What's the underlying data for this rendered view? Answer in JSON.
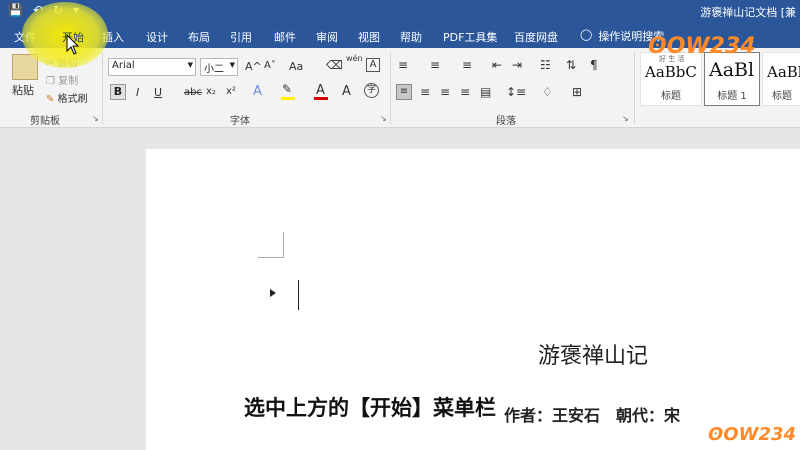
{
  "titlebar": {
    "save_icon": "save-icon",
    "undo_icon": "undo-icon",
    "redo_icon": "redo-icon",
    "doc_title": "游褒禅山记文档 [兼"
  },
  "tabs": [
    "文件",
    "开始",
    "插入",
    "设计",
    "布局",
    "引用",
    "邮件",
    "审阅",
    "视图",
    "帮助",
    "PDF工具集",
    "百度网盘"
  ],
  "tell_me": "操作说明搜索",
  "clipboard": {
    "paste": "粘贴",
    "cut": "剪切",
    "copy": "复制",
    "format_painter": "格式刷",
    "label": "剪贴板"
  },
  "font": {
    "name": "Arial",
    "size": "小二",
    "bold": "B",
    "italic": "I",
    "underline": "U",
    "strike": "abc",
    "subscript": "x₂",
    "superscript": "x²",
    "grow": "A^",
    "shrink": "A˅",
    "case": "Aa",
    "phonetic": "wén",
    "label": "字体"
  },
  "paragraph": {
    "label": "段落"
  },
  "styles": [
    {
      "sample": "AaBbC",
      "name": "标题"
    },
    {
      "sample": "AaBl",
      "name": "标题 1"
    },
    {
      "sample": "AaBb",
      "name": "标题"
    }
  ],
  "document": {
    "heading": "游褒禅山记",
    "author": "作者：王安石　朝代：宋"
  },
  "caption": "选中上方的【开始】菜单栏",
  "watermark": "ʘOW234",
  "colors": {
    "ribbon_blue": "#2b579a",
    "highlight_yellow": "#f5ef1e",
    "font_color_red": "#d40000",
    "highlight_bar": "#fff200"
  }
}
